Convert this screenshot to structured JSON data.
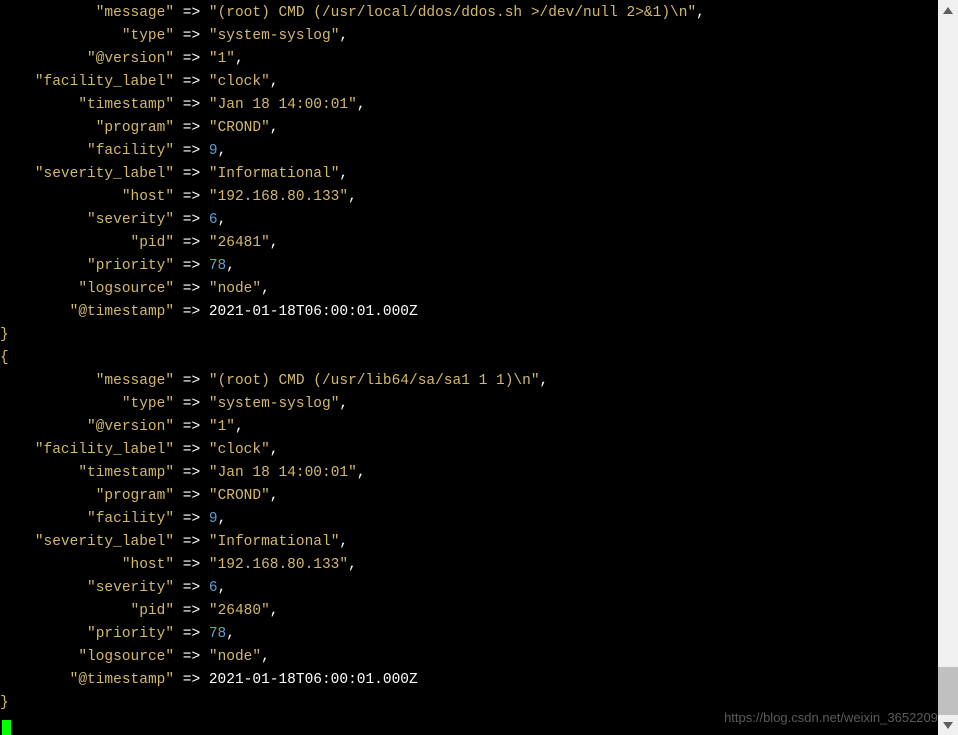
{
  "entries": [
    {
      "message": "(root) CMD (/usr/local/ddos/ddos.sh >/dev/null 2>&1)\\n",
      "type": "system-syslog",
      "at_version": "1",
      "facility_label": "clock",
      "timestamp": "Jan 18 14:00:01",
      "program": "CROND",
      "facility": 9,
      "severity_label": "Informational",
      "host": "192.168.80.133",
      "severity": 6,
      "pid": "26481",
      "priority": 78,
      "logsource": "node",
      "at_timestamp": "2021-01-18T06:00:01.000Z"
    },
    {
      "message": "(root) CMD (/usr/lib64/sa/sa1 1 1)\\n",
      "type": "system-syslog",
      "at_version": "1",
      "facility_label": "clock",
      "timestamp": "Jan 18 14:00:01",
      "program": "CROND",
      "facility": 9,
      "severity_label": "Informational",
      "host": "192.168.80.133",
      "severity": 6,
      "pid": "26480",
      "priority": 78,
      "logsource": "node",
      "at_timestamp": "2021-01-18T06:00:01.000Z"
    }
  ],
  "fields": {
    "message": "message",
    "type": "type",
    "at_version": "@version",
    "facility_label": "facility_label",
    "timestamp": "timestamp",
    "program": "program",
    "facility": "facility",
    "severity_label": "severity_label",
    "host": "host",
    "severity": "severity",
    "pid": "pid",
    "priority": "priority",
    "logsource": "logsource",
    "at_timestamp": "@timestamp"
  },
  "arrow": "=>",
  "brace_close": "}",
  "brace_open": "{",
  "watermark": "https://blog.csdn.net/weixin_3652209"
}
